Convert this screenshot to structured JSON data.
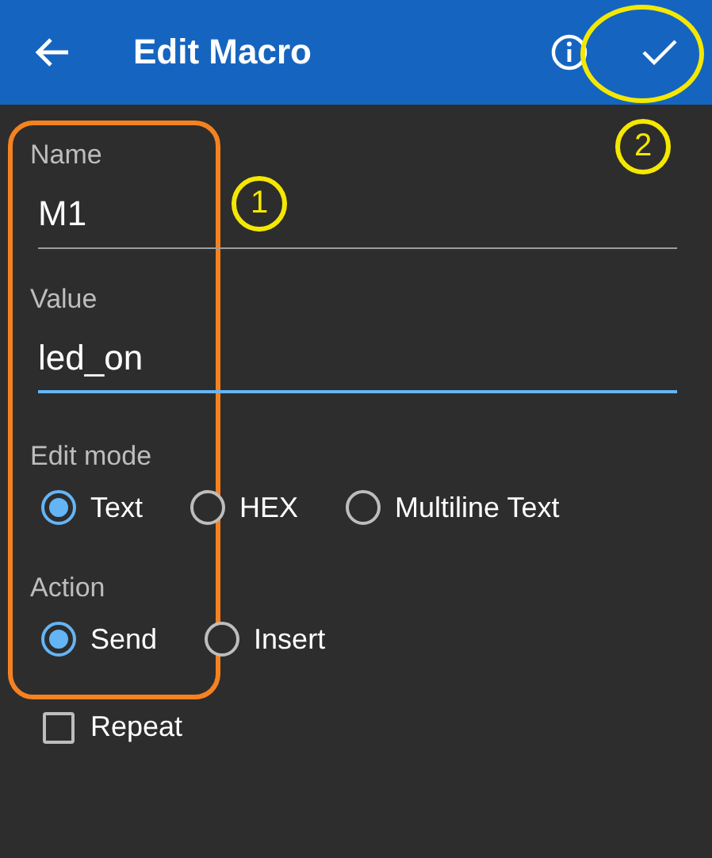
{
  "app_bar": {
    "title": "Edit Macro"
  },
  "fields": [
    {
      "label": "Name",
      "value": "M1",
      "focused": false
    },
    {
      "label": "Value",
      "value": "led_on",
      "focused": true
    }
  ],
  "radio_groups": [
    {
      "label": "Edit mode",
      "options": [
        {
          "label": "Text",
          "selected": true
        },
        {
          "label": "HEX",
          "selected": false
        },
        {
          "label": "Multiline Text",
          "selected": false
        }
      ]
    },
    {
      "label": "Action",
      "options": [
        {
          "label": "Send",
          "selected": true
        },
        {
          "label": "Insert",
          "selected": false
        }
      ]
    }
  ],
  "checkboxes": [
    {
      "label": "Repeat",
      "checked": false
    }
  ],
  "annotations": [
    {
      "kind": "box"
    },
    {
      "kind": "number",
      "text": "1"
    },
    {
      "kind": "number",
      "text": "2"
    },
    {
      "kind": "ellipse"
    }
  ]
}
